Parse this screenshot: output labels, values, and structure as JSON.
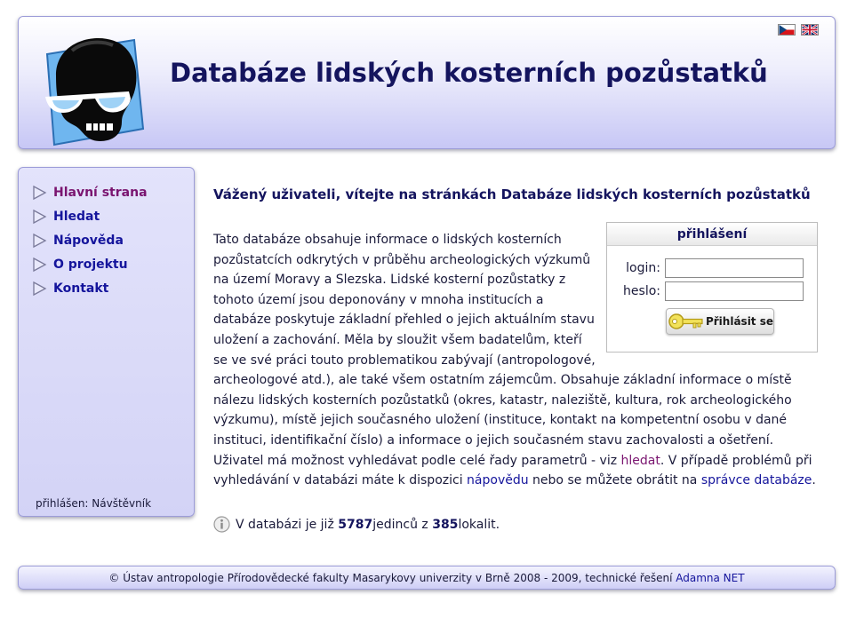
{
  "header": {
    "title": "Databáze lidských kosterních pozůstatků",
    "logo_icon": "skull-with-sunglasses-icon",
    "languages": [
      {
        "code": "cs",
        "icon": "flag-cz-icon"
      },
      {
        "code": "en",
        "icon": "flag-uk-icon"
      }
    ]
  },
  "sidebar": {
    "items": [
      {
        "label": "Hlavní strana",
        "active": true
      },
      {
        "label": "Hledat",
        "active": false
      },
      {
        "label": "Nápověda",
        "active": false
      },
      {
        "label": "O projektu",
        "active": false
      },
      {
        "label": "Kontakt",
        "active": false
      }
    ],
    "logged_in": "přihlášen: Návštěvník"
  },
  "main": {
    "heading": "Vážený uživateli, vítejte na stránkách Databáze lidských kosterních pozůstatků",
    "intro_text_1": "Tato databáze obsahuje informace o lidských kosterních pozůstatcích odkrytých v průběhu archeologických výzkumů na území Moravy a Slezska. Lidské kosterní pozůstatky z tohoto území jsou deponovány v mnoha institucích a databáze poskytuje základní přehled o jejich aktuálním stavu uložení a zachování. Měla by sloužit všem badatelům, kteří se ve své práci touto problematikou zabývají (antropologové, archeologové atd.), ale také všem ostatním zájemcům. Obsahuje základní informace o místě nálezu lidských kosterních pozůstatků (okres, katastr, naleziště, kultura, rok archeologického výzkumu), místě jejich současného uložení (instituce, kontakt na kompetentní osobu v dané instituci, identifikační číslo) a informace o jejich současném stavu zachovalosti a ošetření. Uživatel má možnost vyhledávat podle celé řady parametrů - viz ",
    "link_search": "hledat",
    "intro_text_2": ". V případě problémů při vyhledávání v databázi máte k dispozici ",
    "link_help": "nápovědu",
    "intro_text_3": " nebo se můžete obrátit na ",
    "link_admin": "správce databáze",
    "intro_text_4": ".",
    "stats_prefix": "V databázi je již ",
    "individuals": "5787",
    "stats_middle": " jedinců z ",
    "localities": "385",
    "stats_suffix": " lokalit."
  },
  "login": {
    "title": "přihlášení",
    "login_label": "login:",
    "login_value": "",
    "password_label": "heslo:",
    "password_value": "",
    "button_label": "Přihlásit se",
    "button_icon": "key-icon"
  },
  "footer": {
    "text": "© Ústav antropologie Přírodovědecké fakulty Masarykovy univerzity v Brně 2008 - 2009, technické řešení ",
    "link": "Adamna NET"
  },
  "colors": {
    "title": "#14145e",
    "nav_link": "#15159c",
    "nav_active": "#7a1570",
    "panel_border": "#9c9cd8",
    "panel_bg": "#d3d3f6"
  }
}
